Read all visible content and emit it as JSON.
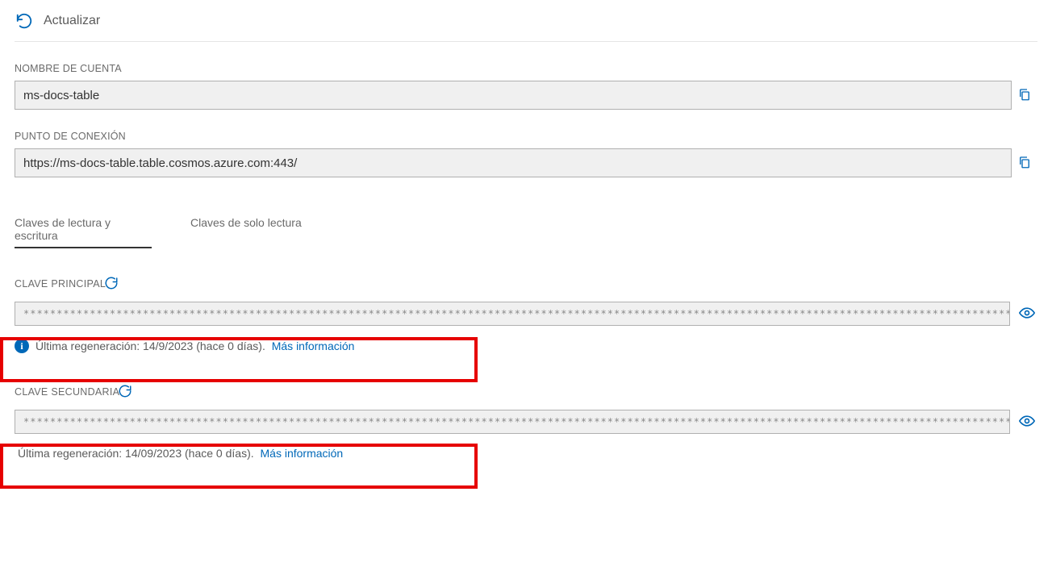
{
  "toolbar": {
    "refresh": "Actualizar"
  },
  "account": {
    "label": "NOMBRE DE CUENTA",
    "value": "ms-docs-table"
  },
  "endpoint": {
    "label": "PUNTO DE CONEXIÓN",
    "value": "https://ms-docs-table.table.cosmos.azure.com:443/"
  },
  "tabs": {
    "rw": "Claves de lectura y escritura",
    "ro": "Claves de solo lectura"
  },
  "keys": {
    "masked": "**********************************************************************************************************************************************************************************************",
    "primary": {
      "label": "CLAVE PRINCIPAL",
      "info": "Última regeneración: 14/9/2023 (hace 0 días).",
      "more": "Más información"
    },
    "secondary": {
      "label": "CLAVE SECUNDARIA",
      "info": "Última regeneración: 14/09/2023 (hace 0 días).",
      "more": "Más información"
    }
  }
}
